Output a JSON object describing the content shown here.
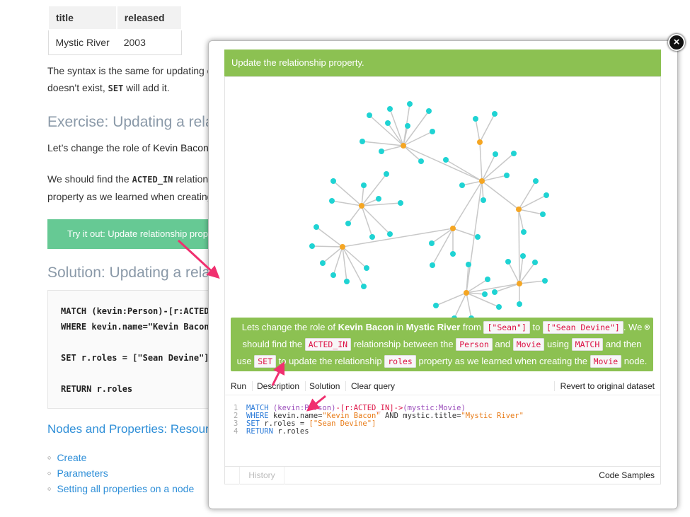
{
  "table": {
    "headers": [
      "title",
      "released"
    ],
    "rows": [
      [
        "Mystic River",
        "2003"
      ]
    ]
  },
  "doc": {
    "para1a": "The syntax is the same for updating or",
    "para1b_pre": "doesn’t exist, ",
    "para1b_code": "SET",
    "para1b_post": " will add it.",
    "exercise_heading": "Exercise: Updating a relation",
    "para2_pre": "Let’s change the role of ",
    "para2_bold": "Kevin Bacon",
    "para2_post": " i",
    "para3_pre": "We should find the ",
    "para3_code": "ACTED_IN",
    "para3_post": " relationsh",
    "para3b": "property as we learned when creating t",
    "tryit": "Try it out: Update relationship properties",
    "solution_heading": "Solution: Updating a relation",
    "solution_code": "MATCH (kevin:Person)-[r:ACTED_IN]->(mystic:Movie)\nWHERE kevin.name=\"Kevin Bacon\" AND mystic.title=\"Mystic River\"\n\nSET r.roles = [\"Sean Devine\"]\n\nRETURN r.roles",
    "resources_heading": "Nodes and Properties: Resources",
    "links": [
      "Create",
      "Parameters",
      "Setting all properties on a node"
    ]
  },
  "modal": {
    "title": "Update the relationship property.",
    "close_icon": "close-icon",
    "description": {
      "t1": "Lets change the role of ",
      "b1": "Kevin Bacon",
      "t2": " in ",
      "b2": "Mystic River",
      "t3": " from ",
      "c1": "[\"Sean\"]",
      "t4": " to ",
      "c2": "[\"Sean Devine\"]",
      "t5": ". We should find the ",
      "c3": "ACTED_IN",
      "t6": " relationship between the ",
      "c4": "Person",
      "t7": " and ",
      "c5": "Movie",
      "t8": " using ",
      "c6": "MATCH",
      "t9": " and then use ",
      "c7": "SET",
      "t10": " to update the relationship ",
      "c8": "roles",
      "t11": " property as we learned when creating the ",
      "c9": "Movie",
      "t12": " node."
    },
    "toolbar": {
      "run": "Run",
      "description": "Description",
      "solution": "Solution",
      "clear": "Clear query",
      "revert": "Revert to original dataset"
    },
    "code_lines": [
      "1",
      "2",
      "3",
      "4"
    ],
    "code": {
      "l1_kw": "MATCH",
      "l1_a": " (kevin:Person)",
      "l1_b": "-[r:ACTED_IN]->",
      "l1_c": "(mystic:Movie)",
      "l2_kw": "WHERE",
      "l2_a": " kevin.name=",
      "l2_s1": "\"Kevin Bacon\"",
      "l2_b": " AND mystic.title=",
      "l2_s2": "\"Mystic River\"",
      "l3_kw": "SET",
      "l3_a": " r.roles = ",
      "l3_s": "[\"Sean Devine\"]",
      "l4_kw": "RETURN",
      "l4_a": " r.roles"
    },
    "footer": {
      "history": "History",
      "samples": "Code Samples"
    }
  },
  "colors": {
    "banner": "#8cc152",
    "tryit": "#66c994",
    "hub": "#f5a623",
    "leaf": "#1fd3d3",
    "arrow": "#f0306f"
  }
}
